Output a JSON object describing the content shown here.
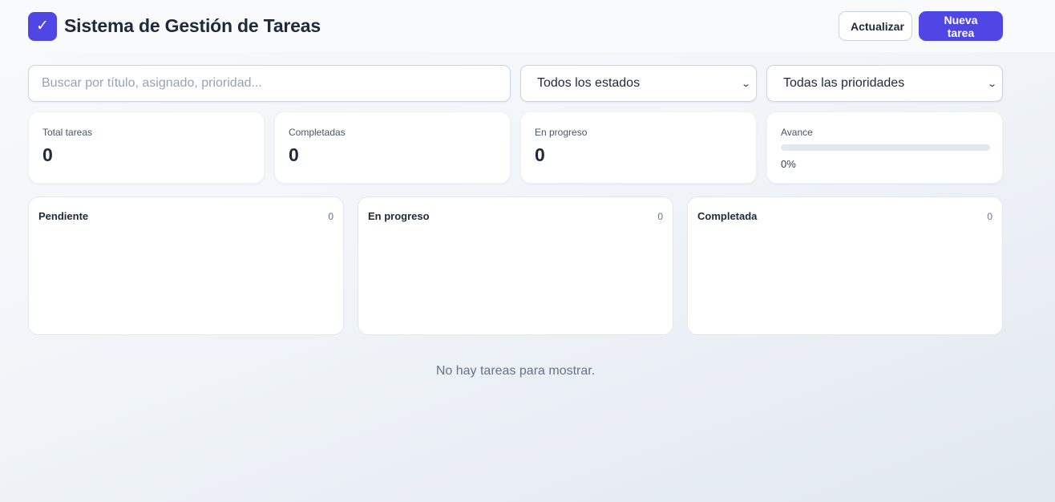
{
  "header": {
    "logo_glyph": "✓",
    "title": "Sistema de Gestión de Tareas",
    "refresh_label": "Actualizar",
    "new_task_label": "Nueva tarea"
  },
  "filters": {
    "search_placeholder": "Buscar por título, asignado, prioridad...",
    "status_selected": "Todos los estados",
    "priority_selected": "Todas las prioridades"
  },
  "stats": {
    "total_label": "Total tareas",
    "total_value": "0",
    "completed_label": "Completadas",
    "completed_value": "0",
    "in_progress_label": "En progreso",
    "in_progress_value": "0",
    "progress_label": "Avance",
    "progress_text": "0%",
    "progress_fraction": 0
  },
  "board": {
    "columns": [
      {
        "title": "Pendiente",
        "count": "0"
      },
      {
        "title": "En progreso",
        "count": "0"
      },
      {
        "title": "Completada",
        "count": "0"
      }
    ]
  },
  "empty_message": "No hay tareas para mostrar.",
  "colors": {
    "accent": "#4f46e5",
    "text": "#1e293b",
    "muted": "#64748b"
  }
}
